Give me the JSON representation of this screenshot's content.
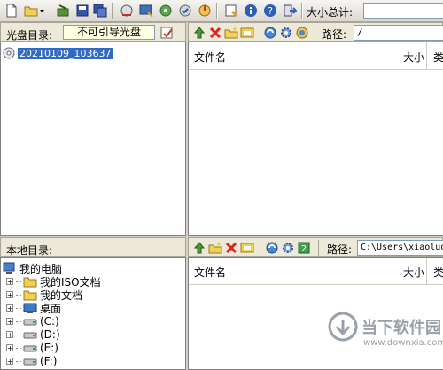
{
  "toolbar": {
    "size_total_label": "大小总计:"
  },
  "disc_panel": {
    "label": "光盘目录:",
    "boot_status": "不可引导光盘",
    "path_label": "路径:",
    "path_value": "/",
    "tree": [
      {
        "label": "20210109_103637",
        "selected": true
      }
    ],
    "columns": [
      "文件名",
      "大小",
      "类"
    ]
  },
  "local_panel": {
    "label": "本地目录:",
    "path_label": "路径:",
    "path_value": "C:\\Users\\xiaoluo\\",
    "columns": [
      "文件名",
      "大小",
      "类"
    ],
    "tree": [
      {
        "label": "我的电脑",
        "icon": "computer-icon",
        "level": 0
      },
      {
        "label": "我的ISO文档",
        "icon": "folder-icon",
        "level": 1
      },
      {
        "label": "我的文档",
        "icon": "folder-icon",
        "level": 1
      },
      {
        "label": "桌面",
        "icon": "desktop-icon",
        "level": 1
      },
      {
        "label": "(C:)",
        "icon": "drive-icon",
        "level": 1
      },
      {
        "label": "(D:)",
        "icon": "drive-icon",
        "level": 1
      },
      {
        "label": "(E:)",
        "icon": "drive-icon",
        "level": 1
      },
      {
        "label": "(F:)",
        "icon": "drive-icon",
        "level": 1
      }
    ]
  },
  "watermark": {
    "brand": "当下软件园",
    "url": "www.downxia.com"
  },
  "colors": {
    "selection": "#316ac5",
    "panel": "#d4d0c8"
  }
}
